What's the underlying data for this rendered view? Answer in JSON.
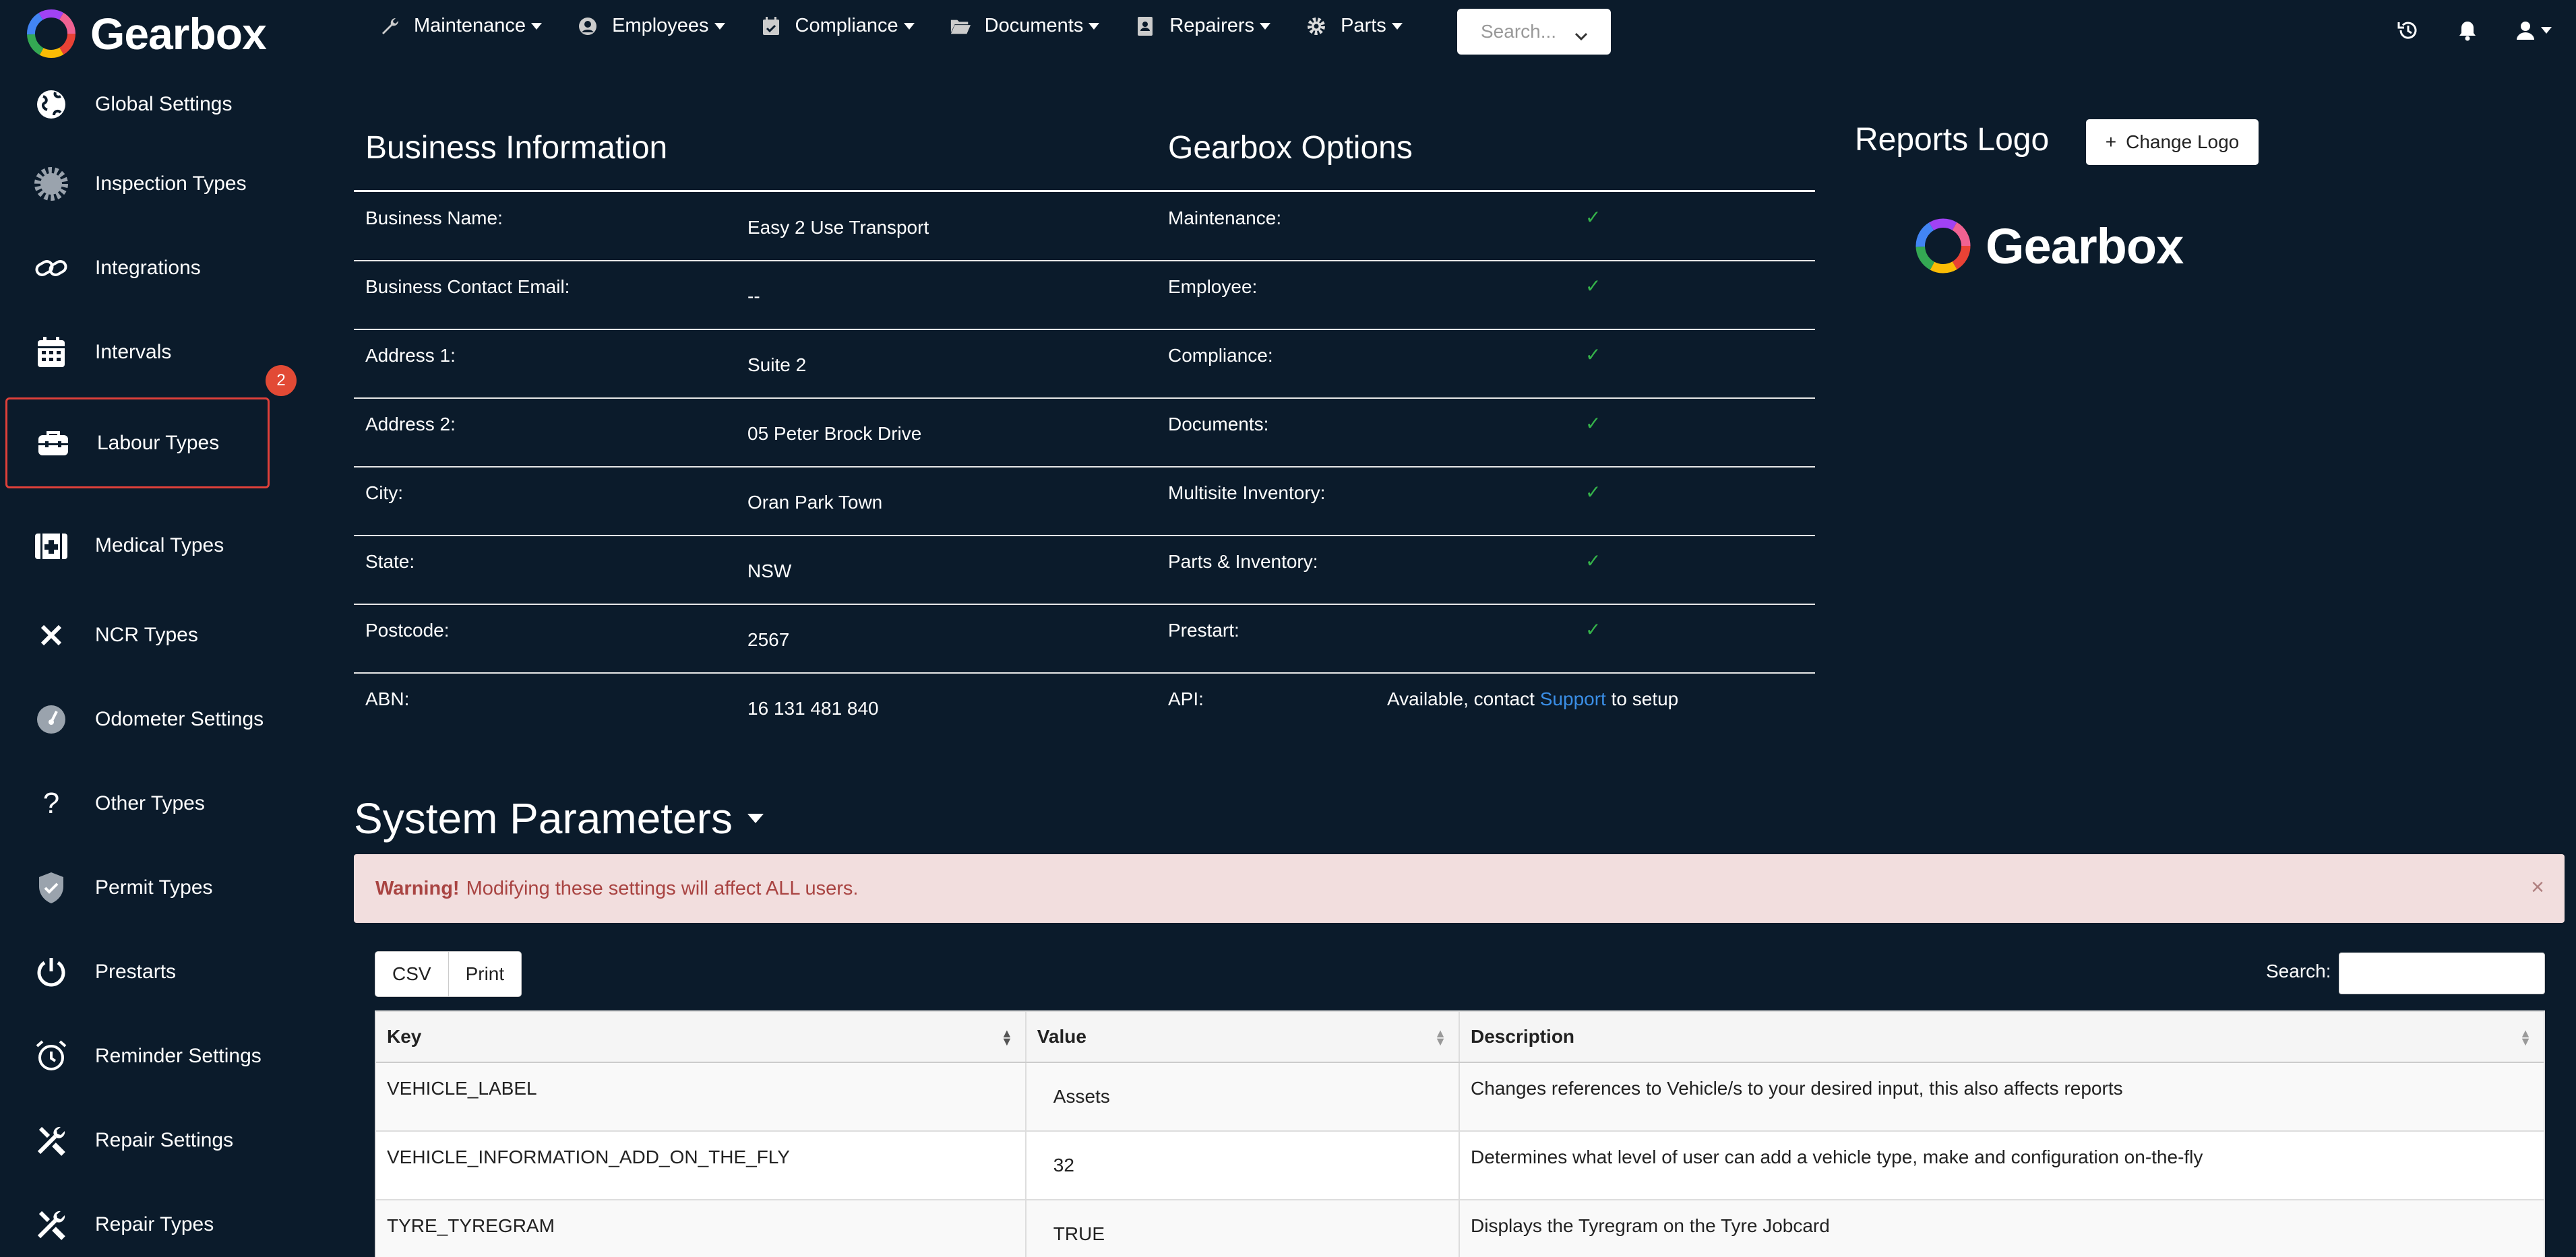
{
  "brand": {
    "name": "Gearbox"
  },
  "nav": {
    "items": [
      {
        "label": "Maintenance",
        "icon": "wrench-icon"
      },
      {
        "label": "Employees",
        "icon": "user-circle-icon"
      },
      {
        "label": "Compliance",
        "icon": "calendar-check-icon"
      },
      {
        "label": "Documents",
        "icon": "folder-open-icon"
      },
      {
        "label": "Repairers",
        "icon": "address-book-icon"
      },
      {
        "label": "Parts",
        "icon": "gear-icon"
      }
    ],
    "search_placeholder": "Search..."
  },
  "sidebar": {
    "items": [
      {
        "label": "Global Settings",
        "icon": "globe-icon"
      },
      {
        "label": "Inspection Types",
        "icon": "badge-gear-icon"
      },
      {
        "label": "Integrations",
        "icon": "link-icon"
      },
      {
        "label": "Intervals",
        "icon": "calendar-icon"
      },
      {
        "label": "Labour Types",
        "icon": "toolbox-icon"
      },
      {
        "label": "Medical Types",
        "icon": "medical-kit-icon"
      },
      {
        "label": "NCR Types",
        "icon": "close-icon"
      },
      {
        "label": "Odometer Settings",
        "icon": "gauge-icon"
      },
      {
        "label": "Other Types",
        "icon": "question-icon"
      },
      {
        "label": "Permit Types",
        "icon": "shield-check-icon"
      },
      {
        "label": "Prestarts",
        "icon": "power-icon"
      },
      {
        "label": "Reminder Settings",
        "icon": "alarm-clock-icon"
      },
      {
        "label": "Repair Settings",
        "icon": "tools-icon"
      },
      {
        "label": "Repair Types",
        "icon": "tools-icon"
      }
    ],
    "badge_count": "2"
  },
  "business": {
    "title": "Business Information",
    "rows": [
      {
        "label": "Business Name:",
        "value": "Easy 2 Use Transport"
      },
      {
        "label": "Business Contact Email:",
        "value": "--"
      },
      {
        "label": "Address 1:",
        "value": "Suite 2"
      },
      {
        "label": "Address 2:",
        "value": "05 Peter Brock Drive"
      },
      {
        "label": "City:",
        "value": "Oran Park Town"
      },
      {
        "label": "State:",
        "value": "NSW"
      },
      {
        "label": "Postcode:",
        "value": "2567"
      },
      {
        "label": "ABN:",
        "value": "16 131 481 840"
      }
    ]
  },
  "options": {
    "title": "Gearbox Options",
    "rows": [
      {
        "label": "Maintenance:",
        "check": "✓"
      },
      {
        "label": "Employee:",
        "check": "✓"
      },
      {
        "label": "Compliance:",
        "check": "✓"
      },
      {
        "label": "Documents:",
        "check": "✓"
      },
      {
        "label": "Multisite Inventory:",
        "check": "✓"
      },
      {
        "label": "Parts & Inventory:",
        "check": "✓"
      },
      {
        "label": "Prestart:",
        "check": "✓"
      }
    ],
    "api_label": "API:",
    "api_text_before": "Available, contact",
    "api_link": "Support",
    "api_text_after": "to setup",
    "check_color": "#35b34a"
  },
  "reports_logo": {
    "title": "Reports Logo",
    "change_button": "Change Logo",
    "logo_text": "Gearbox"
  },
  "system": {
    "title": "System Parameters",
    "warning_strong": "Warning!",
    "warning_text": "Modifying these settings will affect ALL users.",
    "csv_label": "CSV",
    "print_label": "Print",
    "search_label": "Search:",
    "columns": [
      "Key",
      "Value",
      "Description"
    ],
    "rows": [
      {
        "key": "VEHICLE_LABEL",
        "value": "Assets",
        "description": "Changes references to Vehicle/s to your desired input, this also affects reports"
      },
      {
        "key": "VEHICLE_INFORMATION_ADD_ON_THE_FLY",
        "value": "32",
        "description": "Determines what level of user can add a vehicle type, make and configuration on-the-fly"
      },
      {
        "key": "TYRE_TYREGRAM",
        "value": "TRUE",
        "description": "Displays the Tyregram on the Tyre Jobcard"
      }
    ]
  },
  "colors": {
    "background": "#0b1b2b",
    "warning_bg": "#f2dede",
    "warning_text": "#a94442",
    "badge": "#e24a35",
    "active_border": "#e0403a",
    "link": "#3a8ee6"
  }
}
